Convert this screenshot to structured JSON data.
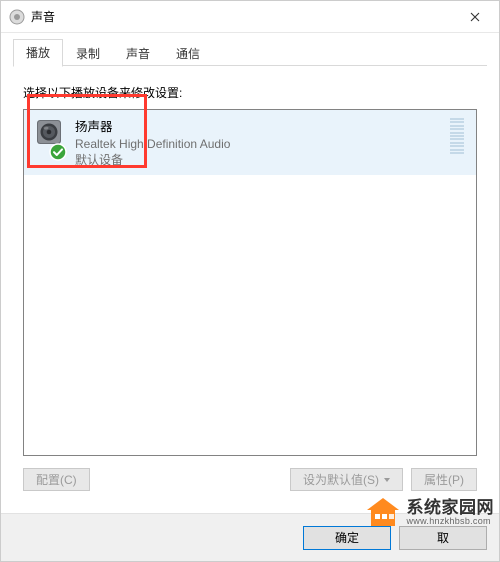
{
  "window": {
    "title": "声音"
  },
  "tabs": [
    {
      "label": "播放",
      "active": true
    },
    {
      "label": "录制",
      "active": false
    },
    {
      "label": "声音",
      "active": false
    },
    {
      "label": "通信",
      "active": false
    }
  ],
  "panel": {
    "instruction": "选择以下播放设备来修改设置:"
  },
  "devices": [
    {
      "name": "扬声器",
      "description": "Realtek High Definition Audio",
      "status": "默认设备",
      "is_default": true
    }
  ],
  "buttons": {
    "configure": "配置(C)",
    "set_default": "设为默认值(S)",
    "properties": "属性(P)"
  },
  "footer": {
    "ok": "确定",
    "cancel": "取"
  },
  "watermark": {
    "cn": "系统家园网",
    "en": "www.hnzkhbsb.com"
  }
}
